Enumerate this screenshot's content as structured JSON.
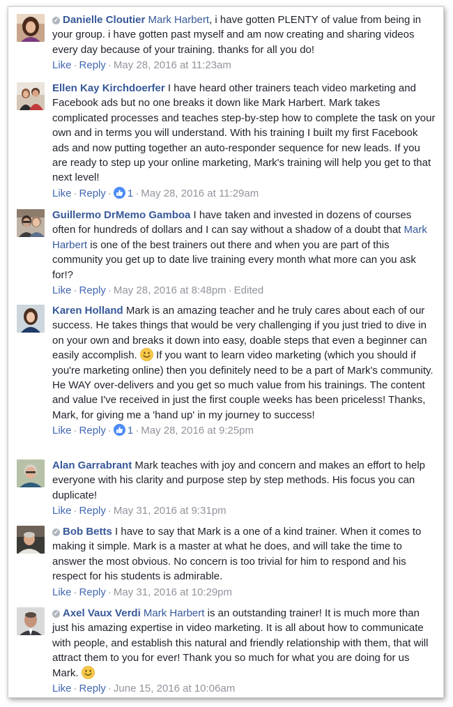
{
  "comments": [
    {
      "author": "Danielle Cloutier",
      "verified": true,
      "mention": "Mark Harbert",
      "text": ", i have gotten PLENTY of value from being in your group. i have gotten past myself and am now creating and sharing videos every day because of your training. thanks for all you do!",
      "like_label": "Like",
      "reply_label": "Reply",
      "timestamp": "May 28, 2016 at 11:23am"
    },
    {
      "author": "Ellen Kay Kirchdoerfer",
      "verified": false,
      "text": " I have heard other trainers teach video marketing and Facebook ads but no one breaks it down like Mark Harbert. Mark takes complicated processes and teaches step-by-step how to complete the task on your own and in terms you will understand. With his training I built my first Facebook ads and now putting together an auto-responder sequence for new leads. If you are ready to step up your online marketing, Mark's training will help you get to that next level!",
      "like_label": "Like",
      "reply_label": "Reply",
      "reactions": "1",
      "timestamp": "May 28, 2016 at 11:29am"
    },
    {
      "author": "Guillermo DrMemo Gamboa",
      "verified": false,
      "text_before": " I have taken and invested in dozens of courses often for hundreds of dollars and I can say without a shadow of a doubt that ",
      "mention": "Mark Harbert",
      "text_after": " is one of the best trainers out there and when you are part of this community you get up to date live training every month what more can you ask for!?",
      "like_label": "Like",
      "reply_label": "Reply",
      "timestamp": "May 28, 2016 at 8:48pm",
      "edited": "Edited"
    },
    {
      "author": "Karen Holland",
      "verified": false,
      "text_before": " Mark is an amazing teacher and he truly cares about each of our success. He takes things that would be very challenging if you just tried to dive in on your own and breaks it down into easy, doable steps that even a beginner can easily accomplish. ",
      "emoji": "smiley",
      "text_after": " If you want to learn video marketing (which you should if you're marketing online) then you definitely need to be a part of Mark's community. He WAY over-delivers and you get so much value from his trainings. The content and value I've received in just the first couple weeks has been priceless! Thanks, Mark, for giving me a 'hand up' in my journey to success!",
      "like_label": "Like",
      "reply_label": "Reply",
      "reactions": "1",
      "timestamp": "May 28, 2016 at 9:25pm"
    },
    {
      "author": "Alan Garrabrant",
      "verified": false,
      "text": " Mark teaches with joy and concern and makes an effort to help everyone with his clarity and purpose step by step methods. His focus you can duplicate!",
      "like_label": "Like",
      "reply_label": "Reply",
      "timestamp": "May 31, 2016 at 9:31pm"
    },
    {
      "author": "Bob Betts",
      "verified": true,
      "text": " I have to say that Mark is a one of a kind trainer. When it comes to making it simple. Mark is a master at what he does, and will take the time to answer the most obvious. No concern is too trivial for him to respond and his respect for his students is admirable.",
      "like_label": "Like",
      "reply_label": "Reply",
      "timestamp": "May 31, 2016 at 10:29pm"
    },
    {
      "author": "Axel Vaux Verdi",
      "verified": true,
      "mention": "Mark Harbert",
      "text_before": " is an outstanding trainer! It is much more than just his amazing expertise in video marketing. It is all about how to communicate with people, and establish this natural and friendly relationship with them, that will attract them to you for ever! Thank you so much for what you are doing for us Mark. ",
      "emoji": "smiley",
      "like_label": "Like",
      "reply_label": "Reply",
      "timestamp": "June 15, 2016 at 10:06am"
    }
  ],
  "icons": {
    "verified": "verified-check-icon",
    "like_reaction": "thumbs-up-icon",
    "emoji": "smiley-face-icon"
  },
  "colors": {
    "author": "#365899",
    "link": "#4267b2",
    "text": "#1d2129",
    "meta": "#90949c",
    "like_badge": "#4b8bf4",
    "emoji": "#f7c948"
  }
}
